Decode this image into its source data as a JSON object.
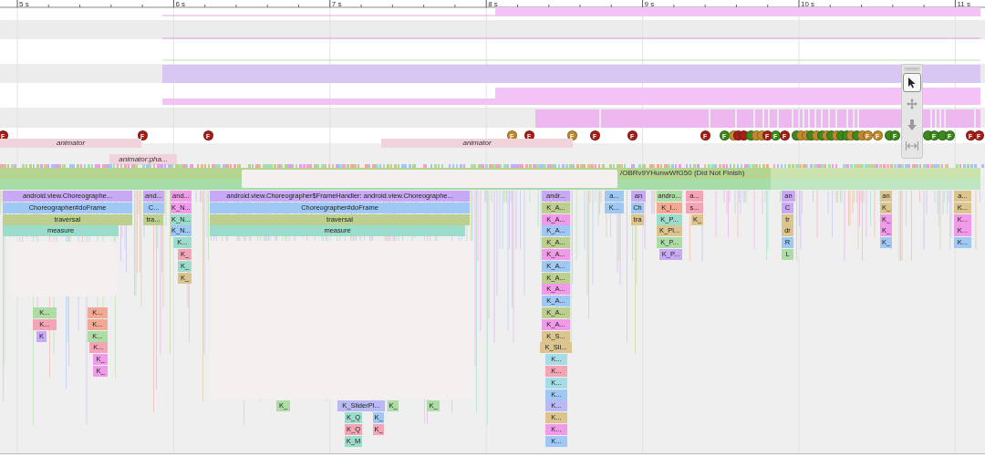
{
  "ruler": {
    "ticks": [
      "5 s",
      "6 s",
      "7 s",
      "8 s",
      "9 s",
      "10 s",
      "11 s"
    ]
  },
  "frames": [
    {
      "label": "F",
      "color": "#a51f17"
    },
    {
      "label": "F",
      "color": "#a51f17"
    },
    {
      "label": "F",
      "color": "#a51f17"
    },
    {
      "label": "F",
      "color": "#c08a2c"
    },
    {
      "label": "F",
      "color": "#a51f17"
    },
    {
      "label": "F",
      "color": "#c08a2c"
    },
    {
      "label": "F",
      "color": "#a51f17"
    },
    {
      "label": "F",
      "color": "#a51f17"
    },
    {
      "label": "F",
      "color": "#a51f17"
    },
    {
      "label": "F",
      "color": "#3d8a1c"
    },
    {
      "color": "#c08a2c"
    },
    {
      "color": "#a51f17"
    },
    {
      "color": "#a51f17"
    },
    {
      "color": "#3d8a1c"
    },
    {
      "color": "#c08a2c"
    },
    {
      "color": "#c08a2c"
    },
    {
      "label": "F",
      "color": "#a51f17"
    },
    {
      "label": "F",
      "color": "#3d8a1c"
    },
    {
      "label": "F",
      "color": "#a51f17"
    },
    {
      "color": "#3d8a1c"
    },
    {
      "color": "#c08a2c"
    },
    {
      "color": "#c08a2c"
    },
    {
      "color": "#3d8a1c"
    },
    {
      "color": "#c08a2c"
    },
    {
      "color": "#3d8a1c"
    },
    {
      "color": "#c08a2c"
    },
    {
      "color": "#3d8a1c"
    },
    {
      "color": "#c08a2c"
    },
    {
      "color": "#3d8a1c"
    },
    {
      "color": "#3d8a1c"
    },
    {
      "color": "#c08a2c"
    },
    {
      "color": "#3d8a1c"
    },
    {
      "color": "#c08a2c"
    },
    {
      "label": "F",
      "color": "#c08a2c"
    },
    {
      "label": "F",
      "color": "#c08a2c"
    },
    {
      "color": "#3d8a1c"
    },
    {
      "label": "F",
      "color": "#3d8a1c"
    },
    {
      "color": "#3d8a1c"
    },
    {
      "label": "F",
      "color": "#3d8a1c"
    },
    {
      "color": "#3d8a1c"
    },
    {
      "label": "F",
      "color": "#3d8a1c"
    },
    {
      "label": "F",
      "color": "#a51f17"
    },
    {
      "label": "F",
      "color": "#a51f17"
    }
  ],
  "async_slices": [
    {
      "label": "animator"
    },
    {
      "label": "animator"
    },
    {
      "label": "animator:pha..."
    }
  ],
  "frame_slice": {
    "label": "/OBRv9YHunwWfG50 (Did Not Finish)"
  },
  "slices": [
    {
      "label": "android.view.Choreographe...",
      "color": "#c8a9f5"
    },
    {
      "label": "and...",
      "color": "#c8a9f5"
    },
    {
      "label": "and...",
      "color": "#f19ae9"
    },
    {
      "label": "android.view.Choreographer$FrameHandler: android.view.Choreographe...",
      "color": "#c8a9f5"
    },
    {
      "label": "andr...",
      "color": "#c8a9f5"
    },
    {
      "label": "a...",
      "color": "#9fc8f5"
    },
    {
      "label": "an",
      "color": "#c8a9f5"
    },
    {
      "label": "andro...",
      "color": "#aedca5"
    },
    {
      "label": "a...",
      "color": "#f3a5b5"
    },
    {
      "label": "an",
      "color": "#c8a9f5"
    },
    {
      "label": "an",
      "color": "#dcc48e"
    },
    {
      "label": "a...",
      "color": "#dcc48e"
    },
    {
      "label": "Choreographer#doFrame",
      "color": "#9fc8f5"
    },
    {
      "label": "C...",
      "color": "#9fc8f5"
    },
    {
      "label": "K_N...",
      "color": "#f19ae9"
    },
    {
      "label": "Choreographer#doFrame",
      "color": "#9fc8f5"
    },
    {
      "label": "K_A...",
      "color": "#bccf8e"
    },
    {
      "label": "K...",
      "color": "#9fc8f5"
    },
    {
      "label": "Ch",
      "color": "#9fc8f5"
    },
    {
      "label": "K_I...",
      "color": "#f2a994"
    },
    {
      "label": "s...",
      "color": "#f3a5b5"
    },
    {
      "label": "C",
      "color": "#c8a9f5"
    },
    {
      "label": "K_",
      "color": "#dcc48e"
    },
    {
      "label": "K...",
      "color": "#dcc48e"
    },
    {
      "label": "traversal",
      "color": "#bccf8e"
    },
    {
      "label": "tra...",
      "color": "#bccf8e"
    },
    {
      "label": "K_N...",
      "color": "#9cdccb"
    },
    {
      "label": "traversal",
      "color": "#bccf8e"
    },
    {
      "label": "K_A...",
      "color": "#f19ae9"
    },
    {
      "label": "tra",
      "color": "#dcc48e"
    },
    {
      "label": "K_P...",
      "color": "#9cdccb"
    },
    {
      "label": "K_",
      "color": "#dcc48e"
    },
    {
      "label": "tr",
      "color": "#dcc48e"
    },
    {
      "label": "K_",
      "color": "#f19ae9"
    },
    {
      "label": "K...",
      "color": "#f19ae9"
    },
    {
      "label": "measure",
      "color": "#9cdccb"
    },
    {
      "label": "K_N...",
      "color": "#9fc8f5"
    },
    {
      "label": "measure",
      "color": "#9cdccb"
    },
    {
      "label": "K_A...",
      "color": "#9fc8f5"
    },
    {
      "label": "K_Pl...",
      "color": "#dcc48e"
    },
    {
      "label": "dr",
      "color": "#dcc48e"
    },
    {
      "label": "K_",
      "color": "#f19ae9"
    },
    {
      "label": "K...",
      "color": "#f19ae9"
    },
    {
      "label": "K...",
      "color": "#9cdccb"
    },
    {
      "label": "K_A...",
      "color": "#bccf8e"
    },
    {
      "label": "K_P...",
      "color": "#aedca5"
    },
    {
      "label": "R",
      "color": "#9fc8f5"
    },
    {
      "label": "K_",
      "color": "#9fc8f5"
    },
    {
      "label": "K...",
      "color": "#9fc8f5"
    },
    {
      "label": "K_",
      "color": "#f3a5b5"
    },
    {
      "label": "K_A...",
      "color": "#f19ae9"
    },
    {
      "label": "K_P...",
      "color": "#c8a9f5"
    },
    {
      "label": "L",
      "color": "#aedca5"
    },
    {
      "label": "K_",
      "color": "#9cdccb"
    },
    {
      "label": "K_A...",
      "color": "#9fc8f5"
    },
    {
      "label": "K_",
      "color": "#dcc48e"
    },
    {
      "label": "K_A...",
      "color": "#bccf8e"
    },
    {
      "label": "K_A...",
      "color": "#f19ae9"
    },
    {
      "label": "K_A...",
      "color": "#9fc8f5"
    },
    {
      "label": "K...",
      "color": "#aedca5"
    },
    {
      "label": "K...",
      "color": "#f2a994"
    },
    {
      "label": "K_A...",
      "color": "#bccf8e"
    },
    {
      "label": "K...",
      "color": "#f3a5b5"
    },
    {
      "label": "K...",
      "color": "#f2a994"
    },
    {
      "label": "K_A...",
      "color": "#f19ae9"
    },
    {
      "label": "K",
      "color": "#c8a9f5"
    },
    {
      "label": "K...",
      "color": "#aedca5"
    },
    {
      "label": "K_S...",
      "color": "#dcc48e"
    },
    {
      "label": "K...",
      "color": "#f3a5b5"
    },
    {
      "label": "K_Sli...",
      "color": "#dcc48e"
    },
    {
      "label": "K_",
      "color": "#f19ae9"
    },
    {
      "label": "K...",
      "color": "#a5dde6"
    },
    {
      "label": "K_",
      "color": "#f19ae9"
    },
    {
      "label": "K...",
      "color": "#f3a5b5"
    },
    {
      "label": "K...",
      "color": "#a5dde6"
    },
    {
      "label": "K...",
      "color": "#9fc8f5"
    },
    {
      "label": "K_",
      "color": "#aedca5"
    },
    {
      "label": "K_SliderPl...",
      "color": "#b9b9f5"
    },
    {
      "label": "K_",
      "color": "#aedca5"
    },
    {
      "label": "K_",
      "color": "#aedca5"
    },
    {
      "label": "K...",
      "color": "#b9b9f5"
    },
    {
      "label": "K_Q",
      "color": "#9cdccb"
    },
    {
      "label": "K_",
      "color": "#9fc8f5"
    },
    {
      "label": "K...",
      "color": "#dcc48e"
    },
    {
      "label": "K_Q",
      "color": "#f3a5b5"
    },
    {
      "label": "K_",
      "color": "#f3a5b5"
    },
    {
      "label": "K...",
      "color": "#f19ae9"
    },
    {
      "label": "K_M",
      "color": "#9cdccb"
    },
    {
      "label": "K...",
      "color": "#9fc8f5"
    }
  ],
  "toolbar": {
    "tools": [
      {
        "kind": "select",
        "selected": true
      },
      {
        "kind": "pan",
        "selected": false
      },
      {
        "kind": "zoom",
        "selected": false
      },
      {
        "kind": "fit",
        "selected": false
      }
    ]
  }
}
